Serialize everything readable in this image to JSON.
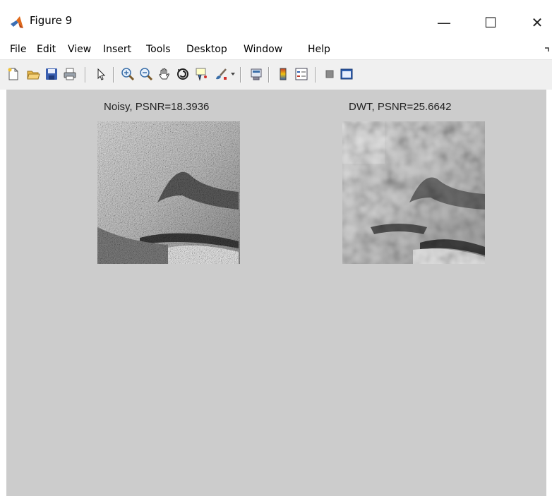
{
  "window": {
    "title": "Figure 9",
    "controls": {
      "minimize": "—",
      "maximize": "☐",
      "close": "✕"
    }
  },
  "menu": [
    "File",
    "Edit",
    "View",
    "Insert",
    "Tools",
    "Desktop",
    "Window",
    "Help"
  ],
  "toolbar": {
    "icons": [
      "new-figure-icon",
      "open-file-icon",
      "save-icon",
      "print-icon",
      "edit-plot-arrow-icon",
      "zoom-in-icon",
      "zoom-out-icon",
      "pan-hand-icon",
      "rotate-3d-icon",
      "data-cursor-icon",
      "brush-icon",
      "link-plot-icon",
      "insert-colorbar-icon",
      "insert-legend-icon",
      "hide-plot-tools-icon",
      "show-plot-tools-icon"
    ]
  },
  "axes": [
    {
      "title": "Noisy, PSNR=18.3936",
      "image": "noisy-grayscale-image"
    },
    {
      "title": "DWT, PSNR=25.6642",
      "image": "dwt-denoised-grayscale-image"
    }
  ],
  "colors": {
    "figure_background": "#cccccc",
    "toolbar_background": "#f0f0f0",
    "window_background": "#ffffff"
  }
}
